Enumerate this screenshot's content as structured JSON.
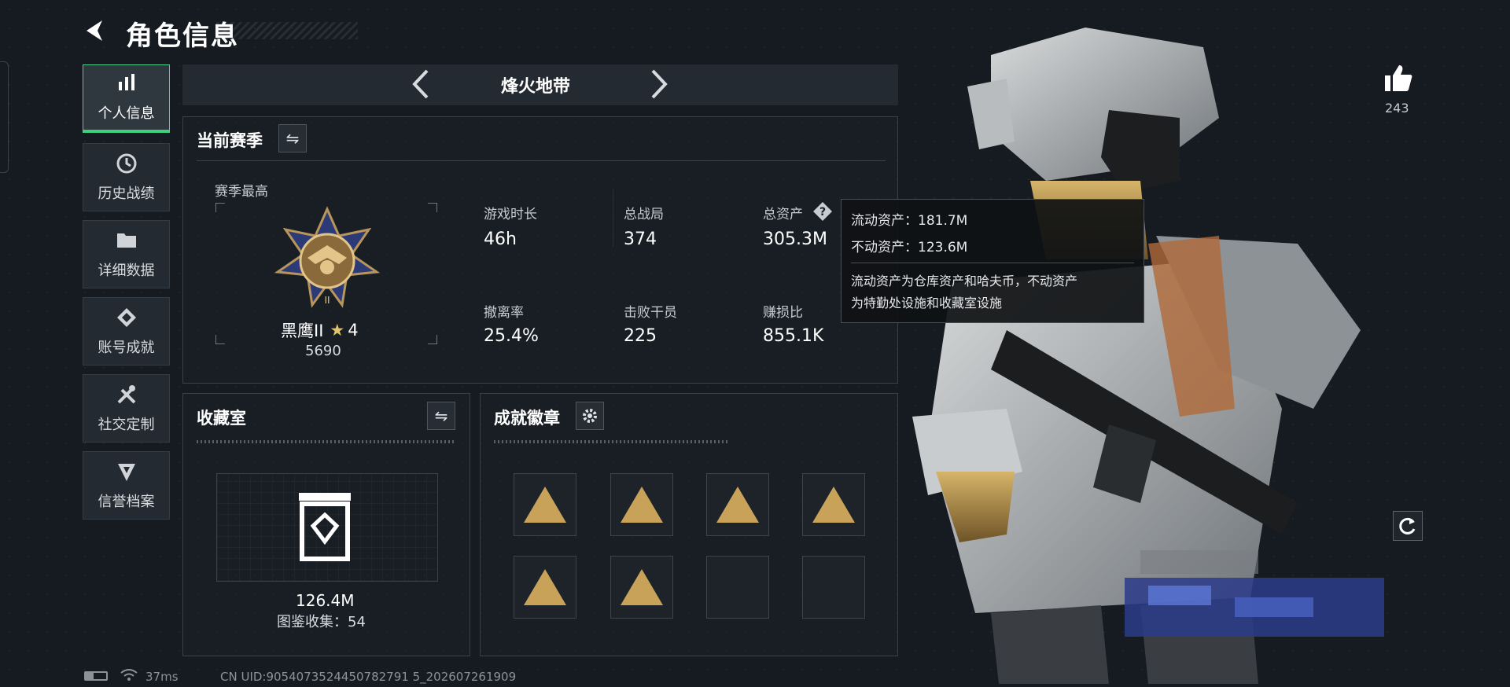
{
  "header": {
    "title": "角色信息"
  },
  "nav": [
    {
      "label": "个人信息",
      "icon": "bar-chart-icon",
      "active": true
    },
    {
      "label": "历史战绩",
      "icon": "clock-icon"
    },
    {
      "label": "详细数据",
      "icon": "folder-icon"
    },
    {
      "label": "账号成就",
      "icon": "achievement-icon"
    },
    {
      "label": "社交定制",
      "icon": "tools-icon"
    },
    {
      "label": "信誉档案",
      "icon": "shield-icon"
    }
  ],
  "map_selector": {
    "name": "烽火地带"
  },
  "season": {
    "heading": "当前赛季",
    "best_label": "赛季最高",
    "rank_name": "黑鹰II",
    "rank_stars": "4",
    "rank_score": "5690",
    "stats": [
      {
        "label": "游戏时长",
        "value": "46h"
      },
      {
        "label": "总战局",
        "value": "374"
      },
      {
        "label": "总资产",
        "value": "305.3M"
      },
      {
        "label": "撤离率",
        "value": "25.4%"
      },
      {
        "label": "击败干员",
        "value": "225"
      },
      {
        "label": "赚损比",
        "value": "855.1K"
      }
    ]
  },
  "tooltip": {
    "liquid": "流动资产：181.7M",
    "fixed": "不动资产：123.6M",
    "desc_line1": "流动资产为仓库资产和哈夫币，不动资产",
    "desc_line2": "为特勤处设施和收藏室设施"
  },
  "collection": {
    "heading": "收藏室",
    "value": "126.4M",
    "count_label": "图鉴收集：54"
  },
  "badges": {
    "heading": "成就徽章",
    "slots": [
      "badge-1",
      "badge-2",
      "badge-3",
      "badge-4",
      "badge-5",
      "badge-6",
      "empty",
      "empty"
    ]
  },
  "likes": {
    "count": "243"
  },
  "status": {
    "ping": "37ms",
    "uid": "CN UID:9054073524450782791 5_202607261909"
  },
  "colors": {
    "accent": "#3fd07c",
    "badge_gold": "#c9a25a",
    "panel_bg": "#232a31"
  }
}
